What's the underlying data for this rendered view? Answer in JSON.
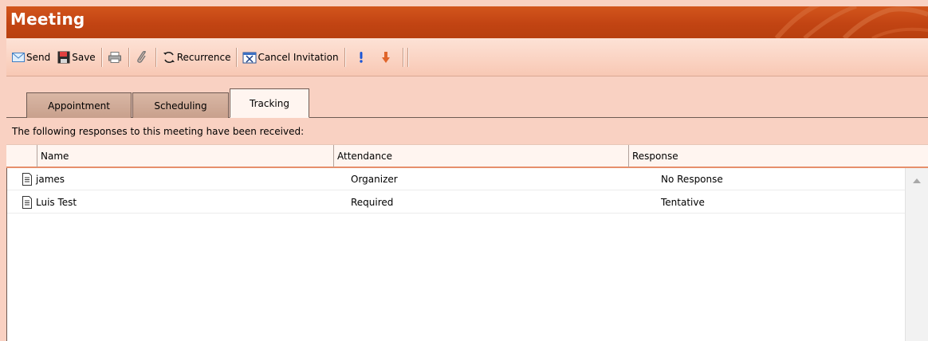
{
  "window": {
    "title": "Meeting"
  },
  "toolbar": {
    "send_label": "Send",
    "save_label": "Save",
    "recurrence_label": "Recurrence",
    "cancel_invitation_label": "Cancel Invitation",
    "icons": [
      "envelope-icon",
      "floppy-disk-icon",
      "printer-icon",
      "paperclip-icon",
      "recurrence-icon",
      "cancel-invitation-icon",
      "high-importance-icon",
      "low-importance-icon"
    ],
    "colors": {
      "high_importance": "#1a55d6",
      "low_importance": "#e0642a"
    }
  },
  "tabs": [
    {
      "label": "Appointment",
      "active": false
    },
    {
      "label": "Scheduling",
      "active": false
    },
    {
      "label": "Tracking",
      "active": true
    }
  ],
  "tracking": {
    "info_text": "The following responses to this meeting have been received:",
    "columns": [
      "Name",
      "Attendance",
      "Response"
    ],
    "rows": [
      {
        "name": "james",
        "attendance": "Organizer",
        "response": "No Response"
      },
      {
        "name": "Luis Test",
        "attendance": "Required",
        "response": "Tentative"
      }
    ]
  },
  "colors": {
    "titlebar": "#c24413",
    "background": "#f9d1c2",
    "header_underline": "#e78f6b"
  }
}
